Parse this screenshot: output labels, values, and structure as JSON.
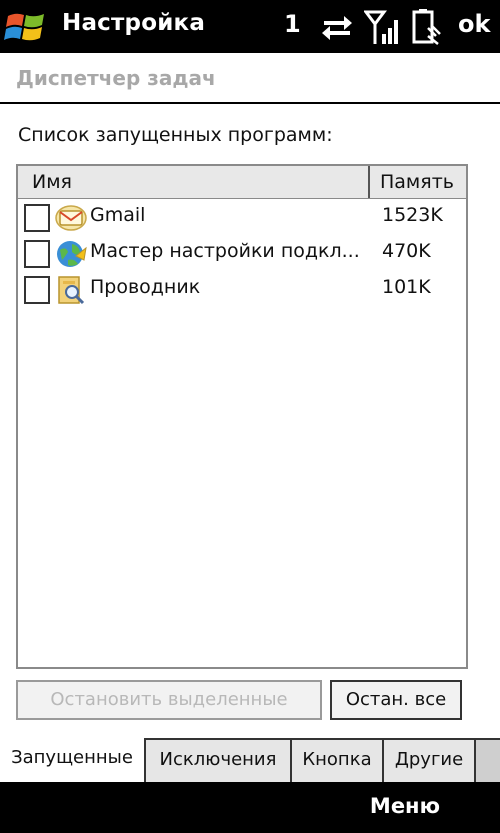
{
  "topbar": {
    "title": "Настройка",
    "notification_count": "1",
    "ok_label": "ok",
    "icons": [
      "windows-logo-icon",
      "sync-arrows-icon",
      "signal-icon",
      "battery-icon"
    ]
  },
  "page": {
    "header": "Диспетчер задач",
    "list_label": "Список запущенных программ:"
  },
  "process_list": {
    "columns": {
      "name": "Имя",
      "memory": "Память"
    },
    "rows": [
      {
        "name": "Gmail",
        "memory": "1523K",
        "icon": "gmail-icon",
        "checked": false
      },
      {
        "name": "Мастер настройки подкл...",
        "memory": "470K",
        "icon": "connection-wizard-icon",
        "checked": false
      },
      {
        "name": "Проводник",
        "memory": "101K",
        "icon": "explorer-icon",
        "checked": false
      }
    ]
  },
  "buttons": {
    "stop_selected": "Остановить выделенные",
    "stop_all": "Остан. все"
  },
  "tabs": [
    {
      "label": "Запущенные",
      "active": true
    },
    {
      "label": "Исключения",
      "active": false
    },
    {
      "label": "Кнопка",
      "active": false
    },
    {
      "label": "Другие",
      "active": false
    }
  ],
  "softkeys": {
    "menu": "Меню"
  },
  "colors": {
    "bar_background": "#000000",
    "header_text": "#a8a8a8",
    "disabled_text": "#b8b8b8"
  }
}
